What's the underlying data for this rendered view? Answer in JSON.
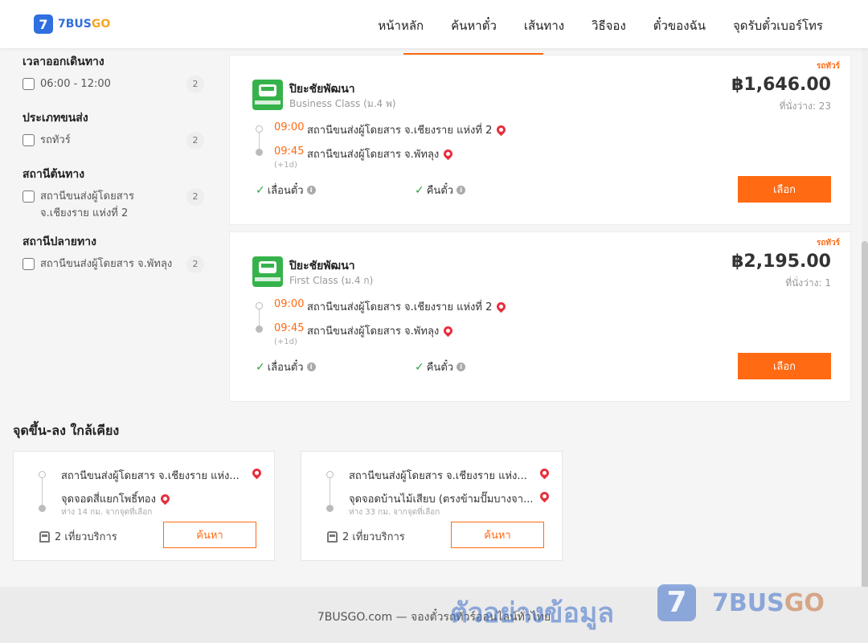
{
  "header": {
    "logo_mark": "7",
    "logo_text_a": "7BUS",
    "logo_text_b": "GO",
    "nav": [
      "หน้าหลัก",
      "ค้นหาตั๋ว",
      "เส้นทาง",
      "วิธีจอง",
      "ตั๋วของฉัน",
      "จุดรับตั๋วเบอร์โทร"
    ]
  },
  "filters": [
    {
      "title": "เวลาออกเดินทาง",
      "options": [
        {
          "label": "06:00 - 12:00",
          "count": "2"
        }
      ]
    },
    {
      "title": "ประเภทขนส่ง",
      "options": [
        {
          "label": "รถทัวร์",
          "count": "2"
        }
      ]
    },
    {
      "title": "สถานีต้นทาง",
      "options": [
        {
          "label": "สถานีขนส่งผู้โดยสาร จ.เชียงราย แห่งที่ 2",
          "count": "2"
        }
      ]
    },
    {
      "title": "สถานีปลายทาง",
      "options": [
        {
          "label": "สถานีขนส่งผู้โดยสาร จ.พัทลุง",
          "count": "2"
        }
      ]
    }
  ],
  "trips": [
    {
      "tag": "รถทัวร์",
      "operator": "ปิยะชัยพัฒนา",
      "class": "Business Class (ม.4 พ)",
      "price": "฿1,646.00",
      "seats": "ที่นั่งว่าง: 23",
      "depart_time": "09:00",
      "depart_stop": "สถานีขนส่งผู้โดยสาร จ.เชียงราย แห่งที่ 2",
      "arrive_time": "09:45",
      "arrive_stop": "สถานีขนส่งผู้โดยสาร จ.พัทลุง",
      "day_offset": "(+1d)",
      "policy_1": "เลื่อนตั๋ว",
      "policy_2": "คืนตั๋ว",
      "select_label": "เลือก"
    },
    {
      "tag": "รถทัวร์",
      "operator": "ปิยะชัยพัฒนา",
      "class": "First Class (ม.4 ก)",
      "price": "฿2,195.00",
      "seats": "ที่นั่งว่าง: 1",
      "depart_time": "09:00",
      "depart_stop": "สถานีขนส่งผู้โดยสาร จ.เชียงราย แห่งที่ 2",
      "arrive_time": "09:45",
      "arrive_stop": "สถานีขนส่งผู้โดยสาร จ.พัทลุง",
      "day_offset": "(+1d)",
      "policy_1": "เลื่อนตั๋ว",
      "policy_2": "คืนตั๋ว",
      "select_label": "เลือก"
    }
  ],
  "nearby": {
    "title": "จุดขึ้น-ลง ใกล้เคียง",
    "cards": [
      {
        "from": "สถานีขนส่งผู้โดยสาร จ.เชียงราย แห่ง...",
        "to": "จุดจอดสี่แยกโพธิ์ทอง",
        "distance": "ห่าง 14 กม. จากจุดที่เลือก",
        "trips": "2 เที่ยวบริการ",
        "button": "ค้นหา"
      },
      {
        "from": "สถานีขนส่งผู้โดยสาร จ.เชียงราย แห่ง...",
        "to": "จุดจอดบ้านไม้เสียบ (ตรงข้ามปั๊มบางจา...",
        "distance": "ห่าง 33 กม. จากจุดที่เลือก",
        "trips": "2 เที่ยวบริการ",
        "button": "ค้นหา"
      }
    ]
  },
  "footer": {
    "text": "7BUSGO.com — จองตั๋วรถทัวร์ออนไลน์ทั่วไทย"
  },
  "watermark": {
    "text": "ตัวอย่างข้อมูล",
    "mark": "7",
    "brand_a": "7BUS",
    "brand_b": "GO"
  },
  "colors": {
    "accent": "#ff6a13",
    "brand_blue": "#2f6fe0",
    "brand_yellow": "#f5a623",
    "pin_red": "#e6303d",
    "check_green": "#2aa43f"
  }
}
